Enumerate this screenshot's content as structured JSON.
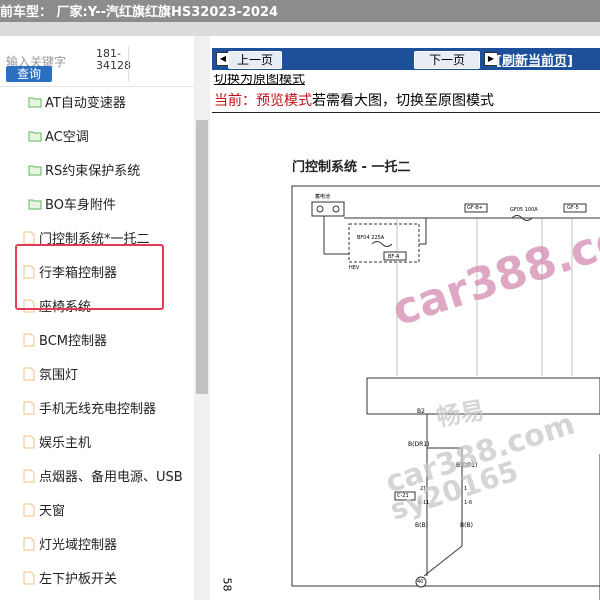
{
  "header": {
    "title": "前车型：  厂家:Y--汽红旗红旗HS32023-2024"
  },
  "search": {
    "label": "输入关键字",
    "button_label": "查询",
    "code_line1": "181-",
    "code_line2": "34128"
  },
  "tree": {
    "items": [
      {
        "label": "AT自动变速器",
        "icon": "folder-green-icon"
      },
      {
        "label": "AC空调",
        "icon": "folder-green-icon"
      },
      {
        "label": "RS约束保护系统",
        "icon": "folder-green-icon"
      },
      {
        "label": "BO车身附件",
        "icon": "folder-green-icon"
      },
      {
        "label": "门控制系统*一托二",
        "icon": "page-icon"
      },
      {
        "label": "行李箱控制器",
        "icon": "page-icon"
      },
      {
        "label": "座椅系统",
        "icon": "page-icon"
      },
      {
        "label": "BCM控制器",
        "icon": "page-icon"
      },
      {
        "label": "氛围灯",
        "icon": "page-icon"
      },
      {
        "label": "手机无线充电控制器",
        "icon": "page-icon"
      },
      {
        "label": "娱乐主机",
        "icon": "page-icon"
      },
      {
        "label": "点烟器、备用电源、USB",
        "icon": "page-icon"
      },
      {
        "label": "天窗",
        "icon": "page-icon"
      },
      {
        "label": "灯光域控制器",
        "icon": "page-icon"
      },
      {
        "label": "左下护板开关",
        "icon": "page-icon"
      }
    ]
  },
  "nav": {
    "prev_label": "上一页",
    "next_label": "下一页",
    "refresh_label": "[刷新当前页]"
  },
  "content": {
    "switch_link": "切换为原图模式",
    "current_prefix": "当前：预览模式",
    "current_suffix": "若需看大图，切换至原图模式"
  },
  "diagram": {
    "title": "门控制系统 - 一托二",
    "page_number": "58",
    "labels": {
      "fuse_box": "蓄电池",
      "gfb": "GF-B+",
      "gf05": "GF05 100A",
      "gf5": "GF-5",
      "bf04": "BF04 225A",
      "bf4": "BF-4",
      "hev": "HEV",
      "b2": "B2",
      "bdr1": "B(DR1)",
      "bdr1b": "B(DR1)",
      "c21": "C-21",
      "p21": "21",
      "p111": "1-11",
      "p1": "1",
      "p16": "1-6",
      "bb": "B(B)",
      "bb2": "B(B)",
      "g40": "40"
    },
    "watermarks": {
      "big": "car388.com",
      "small": "car388.com",
      "hans": "畅易",
      "tail": "sy20165"
    }
  },
  "colors": {
    "nav_bar": "#1d4f9a",
    "highlight": "#e53a55",
    "red_text": "#c31018",
    "folder": "#5cb85c",
    "page": "#f0c080"
  }
}
